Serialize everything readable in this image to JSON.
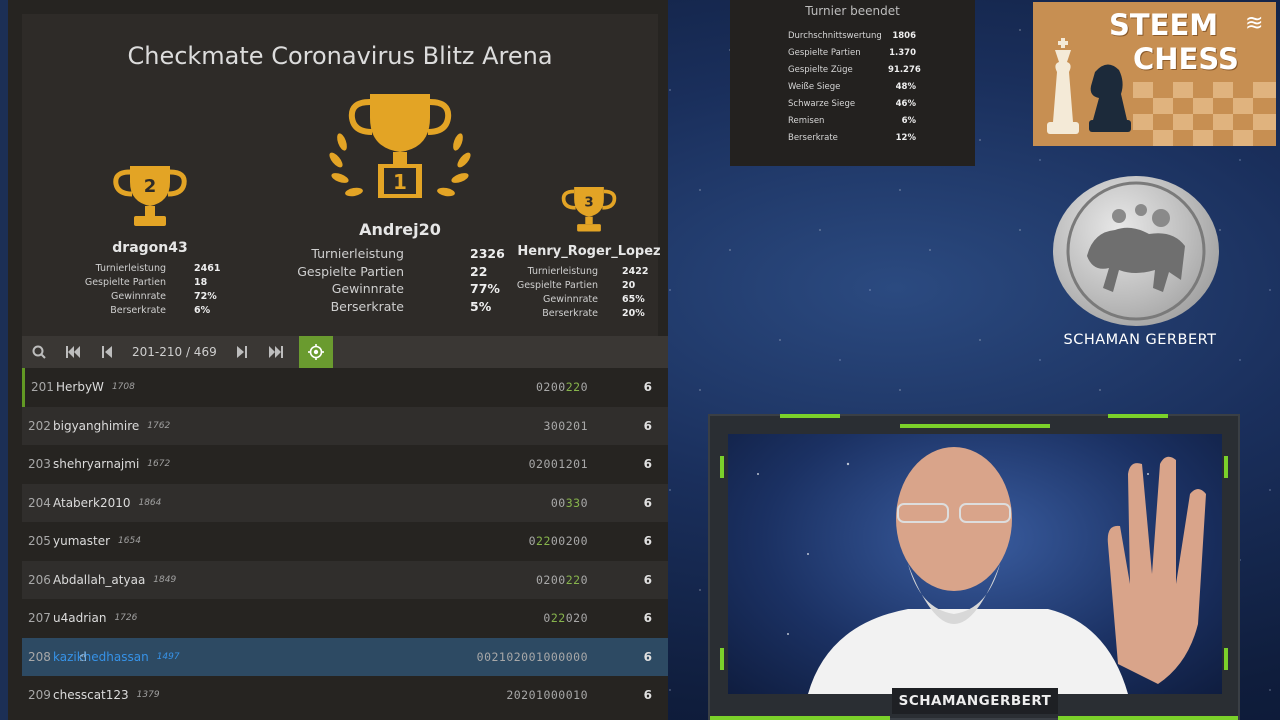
{
  "tournament": {
    "title": "Checkmate Coronavirus Blitz Arena",
    "podium": [
      {
        "place": "2",
        "name": "dragon43",
        "stats": [
          [
            "Turnierleistung",
            "2461"
          ],
          [
            "Gespielte Partien",
            "18"
          ],
          [
            "Gewinnrate",
            "72%"
          ],
          [
            "Berserkrate",
            "6%"
          ]
        ]
      },
      {
        "place": "1",
        "name": "Andrej20",
        "stats": [
          [
            "Turnierleistung",
            "2326"
          ],
          [
            "Gespielte Partien",
            "22"
          ],
          [
            "Gewinnrate",
            "77%"
          ],
          [
            "Berserkrate",
            "5%"
          ]
        ]
      },
      {
        "place": "3",
        "name": "Henry_Roger_Lopez",
        "stats": [
          [
            "Turnierleistung",
            "2422"
          ],
          [
            "Gespielte Partien",
            "20"
          ],
          [
            "Gewinnrate",
            "65%"
          ],
          [
            "Berserkrate",
            "20%"
          ]
        ]
      }
    ],
    "pager": {
      "range": "201-210 / 469"
    },
    "rows": [
      {
        "rank": "201",
        "name": "HerbyW",
        "rating": "1708",
        "sheet": [
          [
            "0200",
            ""
          ],
          [
            "22",
            "g"
          ],
          [
            "0",
            ""
          ]
        ],
        "score": "6"
      },
      {
        "rank": "202",
        "name": "bigyanghimire",
        "rating": "1762",
        "sheet": [
          [
            "300201",
            ""
          ]
        ],
        "score": "6"
      },
      {
        "rank": "203",
        "name": "shehryarnajmi",
        "rating": "1672",
        "sheet": [
          [
            "02001201",
            ""
          ]
        ],
        "score": "6"
      },
      {
        "rank": "204",
        "name": "Ataberk2010",
        "rating": "1864",
        "sheet": [
          [
            "00",
            ""
          ],
          [
            "33",
            "g"
          ],
          [
            "0",
            ""
          ]
        ],
        "score": "6"
      },
      {
        "rank": "205",
        "name": "yumaster",
        "rating": "1654",
        "sheet": [
          [
            "0",
            ""
          ],
          [
            "22",
            "g"
          ],
          [
            "00200",
            ""
          ]
        ],
        "score": "6"
      },
      {
        "rank": "206",
        "name": "Abdallah_atyaa",
        "rating": "1849",
        "sheet": [
          [
            "0200",
            ""
          ],
          [
            "22",
            "g"
          ],
          [
            "0",
            ""
          ]
        ],
        "score": "6"
      },
      {
        "rank": "207",
        "name": "u4adrian",
        "rating": "1726",
        "sheet": [
          [
            "0",
            ""
          ],
          [
            "22",
            "g"
          ],
          [
            "020",
            ""
          ]
        ],
        "score": "6"
      },
      {
        "rank": "208",
        "name": "kazikhedhassan",
        "rating": "1497",
        "sheet": [
          [
            "002102001000000",
            ""
          ]
        ],
        "score": "6"
      },
      {
        "rank": "209",
        "name": "chesscat123",
        "rating": "1379",
        "sheet": [
          [
            "20201000010",
            ""
          ]
        ],
        "score": "6"
      }
    ]
  },
  "stats_box": {
    "header": "Turnier beendet",
    "rows": [
      [
        "Durchschnittswertung",
        "1806"
      ],
      [
        "Gespielte Partien",
        "1.370"
      ],
      [
        "Gespielte Züge",
        "91.276"
      ],
      [
        "Weiße Siege",
        "48%"
      ],
      [
        "Schwarze Siege",
        "46%"
      ],
      [
        "Remisen",
        "6%"
      ],
      [
        "Berserkrate",
        "12%"
      ]
    ]
  },
  "logo": {
    "line1": "STEEM",
    "line2": "CHESS"
  },
  "coin_label": "SCHAMAN GERBERT",
  "webcam_name": "SCHAMANGERBERT",
  "colors": {
    "accent_green": "#629924",
    "highlight_row": "#2d4a63",
    "trophy_gold": "#e3a425"
  }
}
